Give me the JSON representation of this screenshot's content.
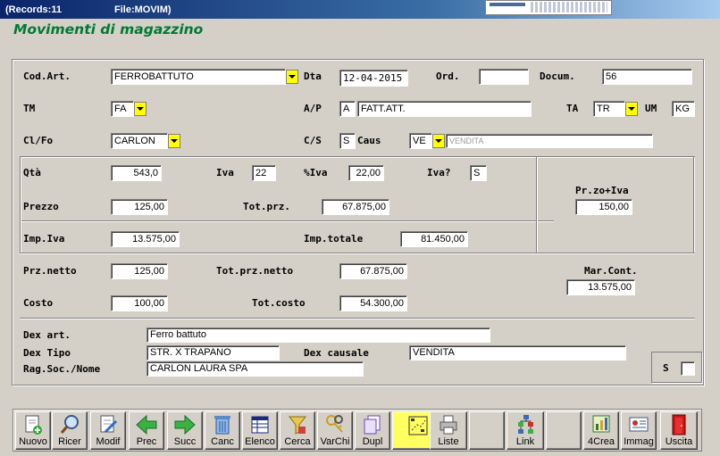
{
  "window": {
    "records": "(Records:11",
    "file": "File:MOVIM)"
  },
  "form_title": "Movimenti di magazzino",
  "labels": {
    "cod_art": "Cod.Art.",
    "dta": "Dta",
    "ord": "Ord.",
    "docum": "Docum.",
    "tm": "TM",
    "ap": "A/P",
    "ta": "TA",
    "um": "UM",
    "clfo": "Cl/Fo",
    "cs": "C/S",
    "caus": "Caus",
    "qta": "Qtà",
    "iva": "Iva",
    "piva": "%Iva",
    "iva_q": "Iva?",
    "prezzo": "Prezzo",
    "tot_prz": "Tot.prz.",
    "przo_iva": "Pr.zo+Iva",
    "imp_iva": "Imp.Iva",
    "imp_totale": "Imp.totale",
    "prz_netto": "Prz.netto",
    "tot_prz_netto": "Tot.prz.netto",
    "mar_cont": "Mar.Cont.",
    "costo": "Costo",
    "tot_costo": "Tot.costo",
    "dex_art": "Dex art.",
    "dex_tipo": "Dex Tipo",
    "dex_causale": "Dex causale",
    "rag_soc": "Rag.Soc./Nome",
    "s": "S"
  },
  "fields": {
    "cod_art": "FERROBATTUTO",
    "dta": "12-04-2015",
    "ord": "",
    "docum": "56",
    "tm": "FA",
    "ap_code": "A",
    "ap_desc": "FATT.ATT.",
    "ta": "TR",
    "um": "KG",
    "clfo": "CARLON",
    "cs": "S",
    "caus": "VE",
    "caus_desc": "VENDITA",
    "qta": "543,0",
    "iva": "22",
    "piva": "22,00",
    "iva_q": "S",
    "prezzo": "125,00",
    "tot_prz": "67.875,00",
    "przo_iva": "150,00",
    "imp_iva": "13.575,00",
    "imp_totale": "81.450,00",
    "prz_netto": "125,00",
    "tot_prz_netto": "67.875,00",
    "mar_cont": "13.575,00",
    "costo": "100,00",
    "tot_costo": "54.300,00",
    "dex_art": "Ferro battuto",
    "dex_tipo": "STR. X TRAPANO",
    "dex_causale": "VENDITA",
    "rag_soc": "CARLON LAURA SPA"
  },
  "toolbar": [
    {
      "label": "Nuovo",
      "icon": "new-document-icon"
    },
    {
      "label": "Ricer",
      "icon": "magnifier-icon"
    },
    {
      "label": "Modif",
      "icon": "edit-document-icon"
    },
    {
      "label": "Prec",
      "icon": "arrow-left-icon"
    },
    {
      "label": "Succ",
      "icon": "arrow-right-icon"
    },
    {
      "label": "Canc",
      "icon": "trash-icon"
    },
    {
      "label": "Elenco",
      "icon": "list-table-icon"
    },
    {
      "label": "Cerca",
      "icon": "filter-icon"
    },
    {
      "label": "VarChi",
      "icon": "keys-icon"
    },
    {
      "label": "Dupl",
      "icon": "duplicate-icon"
    },
    {
      "label": "",
      "icon": "flowchart-icon"
    },
    {
      "label": "Liste",
      "icon": "printer-icon"
    },
    {
      "label": "",
      "icon": ""
    },
    {
      "label": "Link",
      "icon": "link-tree-icon"
    },
    {
      "label": "",
      "icon": ""
    },
    {
      "label": "4Crea",
      "icon": "create-chart-icon"
    },
    {
      "label": "Immag",
      "icon": "image-card-icon"
    },
    {
      "label": "Uscita",
      "icon": "exit-door-icon"
    }
  ]
}
